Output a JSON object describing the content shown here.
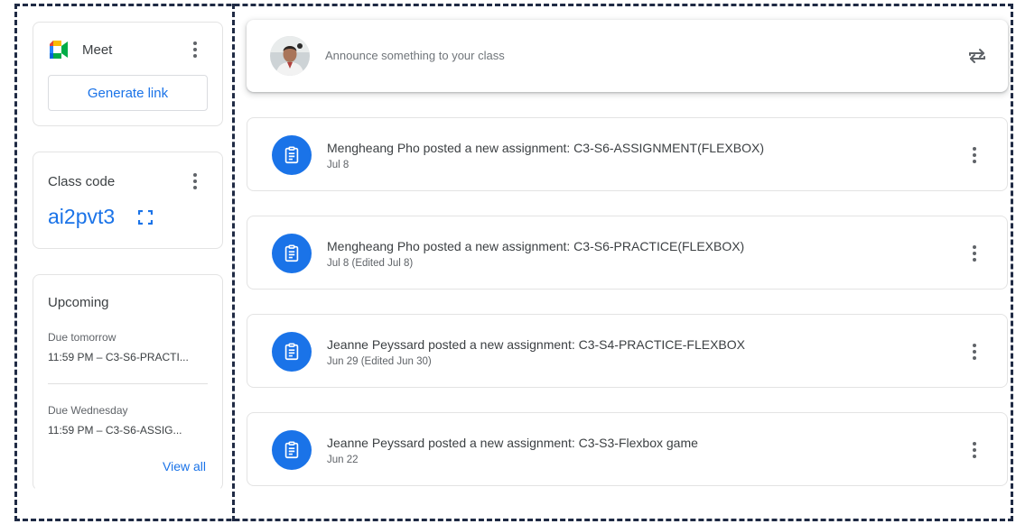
{
  "sidebar": {
    "meet": {
      "title": "Meet",
      "generate_label": "Generate link"
    },
    "class_code": {
      "label": "Class code",
      "value": "ai2pvt3"
    },
    "upcoming": {
      "title": "Upcoming",
      "items": [
        {
          "due": "Due tomorrow",
          "task": "11:59 PM – C3-S6-PRACTI..."
        },
        {
          "due": "Due Wednesday",
          "task": "11:59 PM – C3-S6-ASSIG..."
        }
      ],
      "view_all_label": "View all"
    }
  },
  "announce": {
    "placeholder": "Announce something to your class"
  },
  "stream": [
    {
      "title": "Mengheang Pho posted a new assignment: C3-S6-ASSIGNMENT(FLEXBOX)",
      "date": "Jul 8"
    },
    {
      "title": "Mengheang Pho posted a new assignment: C3-S6-PRACTICE(FLEXBOX)",
      "date": "Jul 8 (Edited Jul 8)"
    },
    {
      "title": "Jeanne Peyssard posted a new assignment: C3-S4-PRACTICE-FLEXBOX",
      "date": "Jun 29 (Edited Jun 30)"
    },
    {
      "title": "Jeanne Peyssard posted a new assignment: C3-S3-Flexbox game",
      "date": "Jun 22"
    }
  ],
  "colors": {
    "accent": "#1a73e8",
    "frame": "#1f2a44",
    "text": "#3c4043",
    "muted": "#5f6368"
  },
  "icons": {
    "meet": "google-meet-icon",
    "expand": "fullscreen-icon",
    "more": "more-vert-icon",
    "repost": "repost-icon",
    "assignment": "assignment-icon"
  }
}
